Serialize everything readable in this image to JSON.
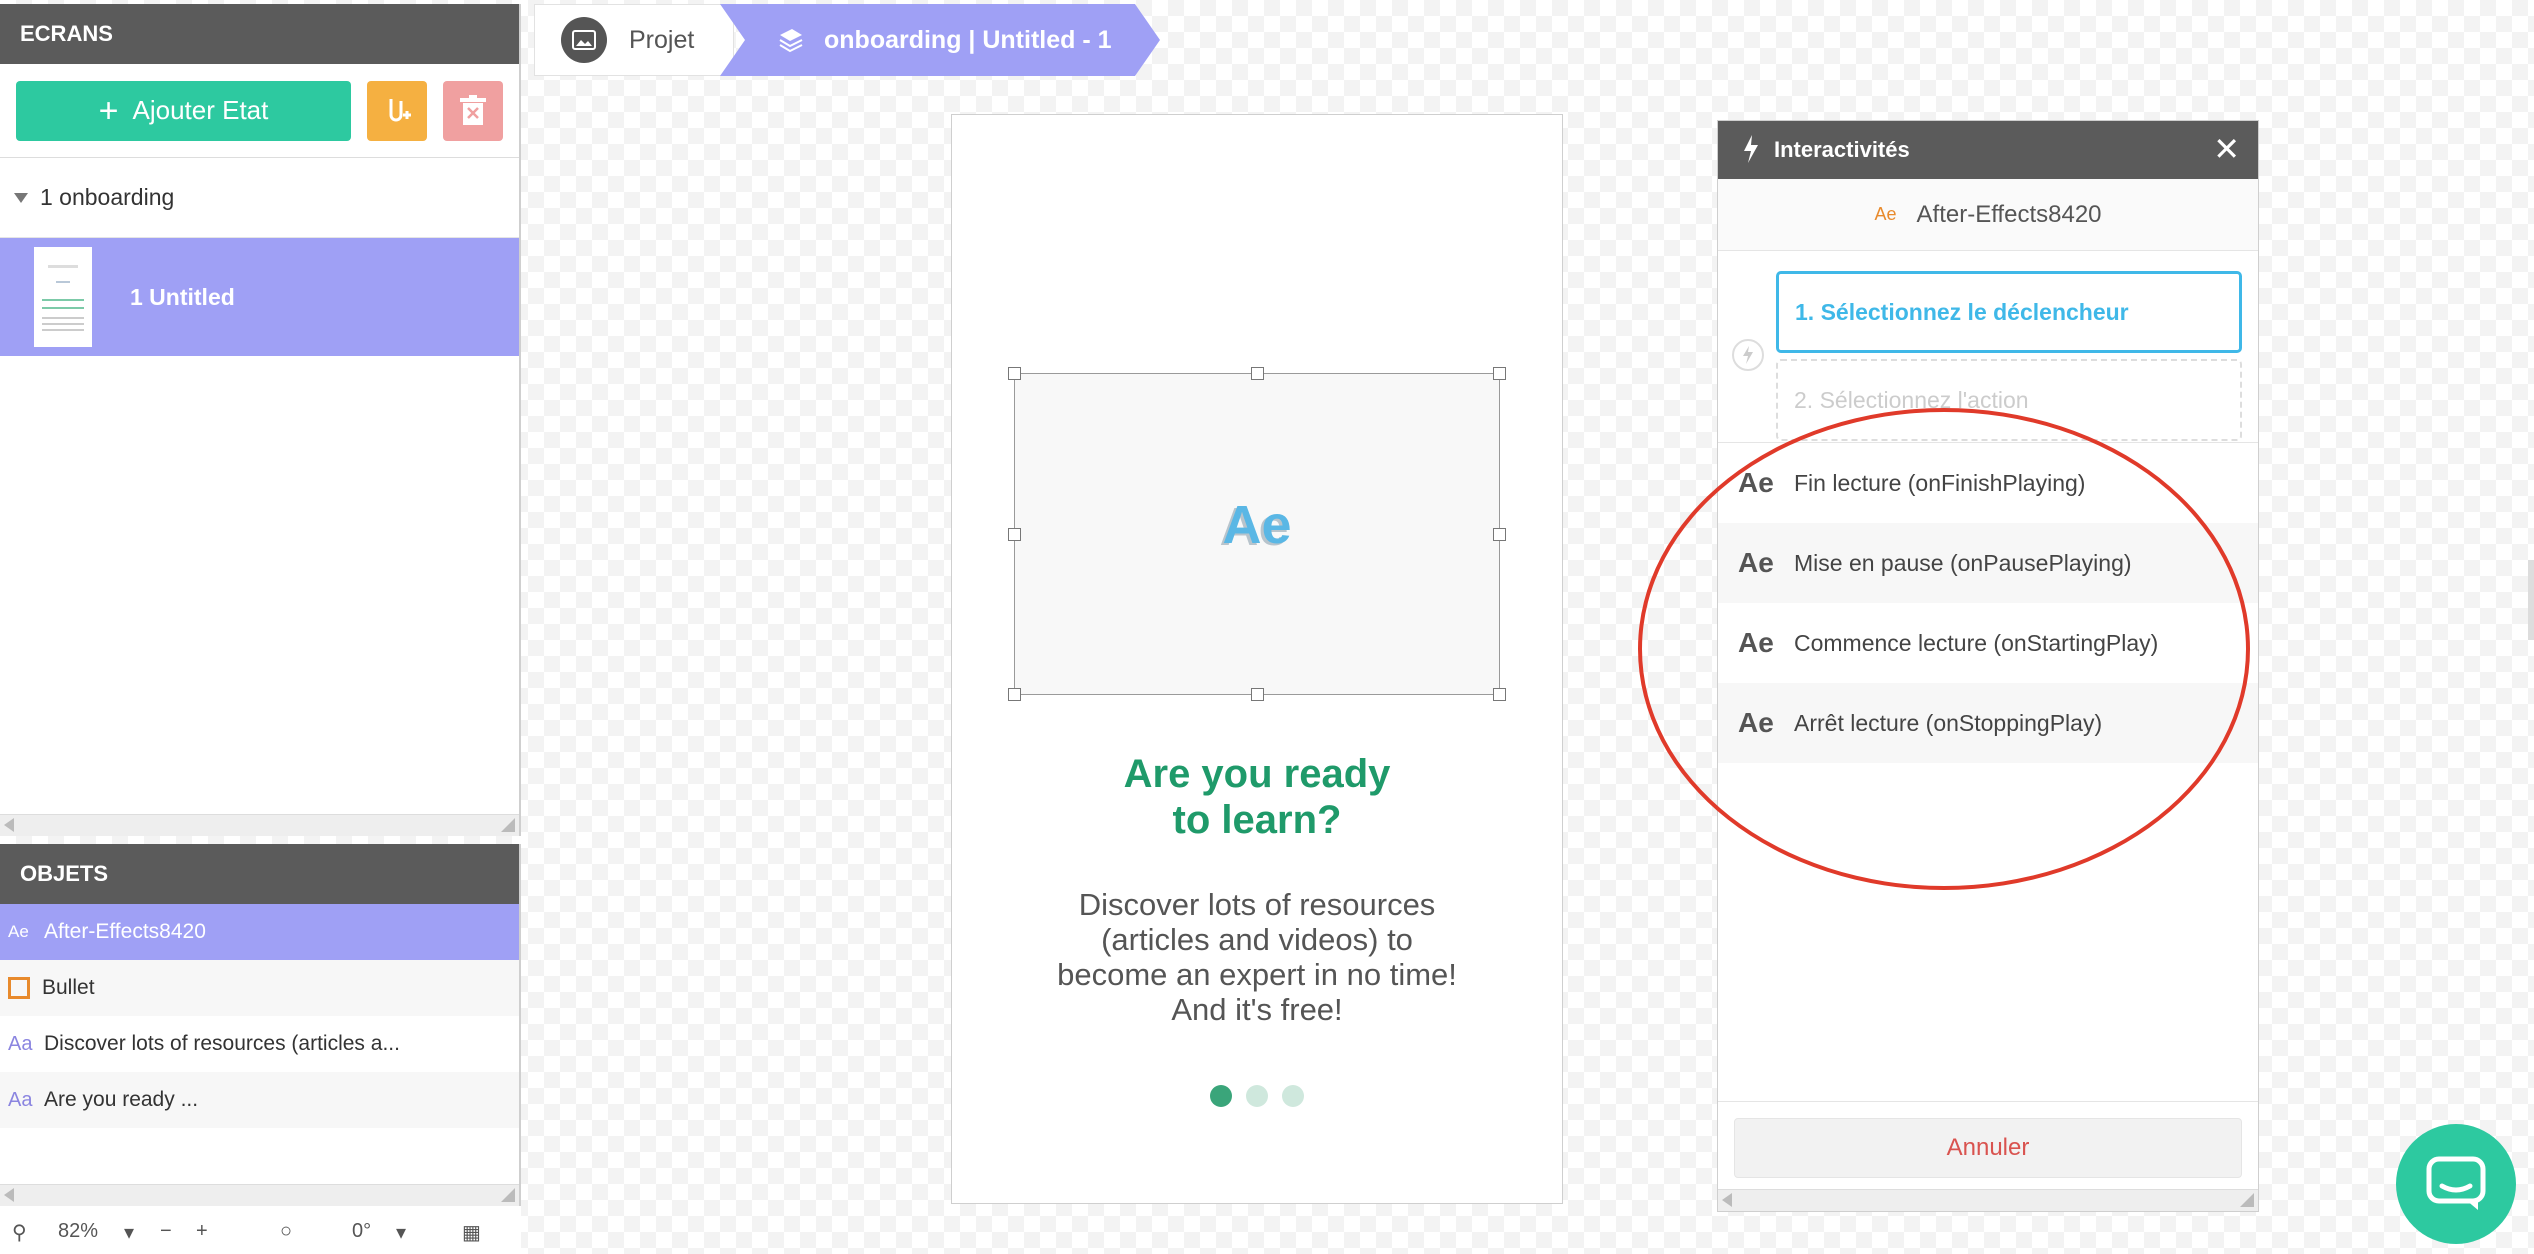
{
  "ecrans_panel": {
    "title": "ECRANS",
    "add_state_label": "Ajouter Etat",
    "groups": [
      {
        "label": "1 onboarding",
        "screens": [
          {
            "label": "1 Untitled"
          }
        ]
      }
    ]
  },
  "objets_panel": {
    "title": "OBJETS",
    "items": [
      {
        "icon": "Ae",
        "label": "After-Effects8420"
      },
      {
        "icon": "bullet-icon",
        "label": "Bullet"
      },
      {
        "icon": "Aa",
        "label": "Discover lots of resources (articles a..."
      },
      {
        "icon": "Aa",
        "label": "Are you ready ..."
      }
    ]
  },
  "bottom_toolbar": {
    "zoom": "82%",
    "rotation": "0°"
  },
  "breadcrumb": {
    "home": "Projet",
    "current": "onboarding | Untitled - 1"
  },
  "phone": {
    "ae_logo": "Ae",
    "title_line1": "Are you ready",
    "title_line2": "to learn?",
    "desc_line1": "Discover lots of resources",
    "desc_line2": "(articles and videos) to",
    "desc_line3": "become an expert in no time!",
    "desc_line4": "And it's free!",
    "pager": {
      "count": 3,
      "active": 1
    }
  },
  "interactivites": {
    "title": "Interactivités",
    "object_icon": "Ae",
    "object_name": "After-Effects8420",
    "step1": "1. Sélectionnez le déclencheur",
    "step2": "2. Sélectionnez l'action",
    "trigger_icon": "Ae",
    "triggers": [
      "Fin lecture (onFinishPlaying)",
      "Mise en pause (onPausePlaying)",
      "Commence lecture (onStartingPlay)",
      "Arrêt lecture (onStoppingPlay)"
    ],
    "cancel": "Annuler"
  },
  "colors": {
    "accent_teal": "#2dc9a0",
    "selection_purple": "#9fa0f5",
    "annotation_red": "#e03a2a",
    "header_gray": "#5b5b5b"
  }
}
